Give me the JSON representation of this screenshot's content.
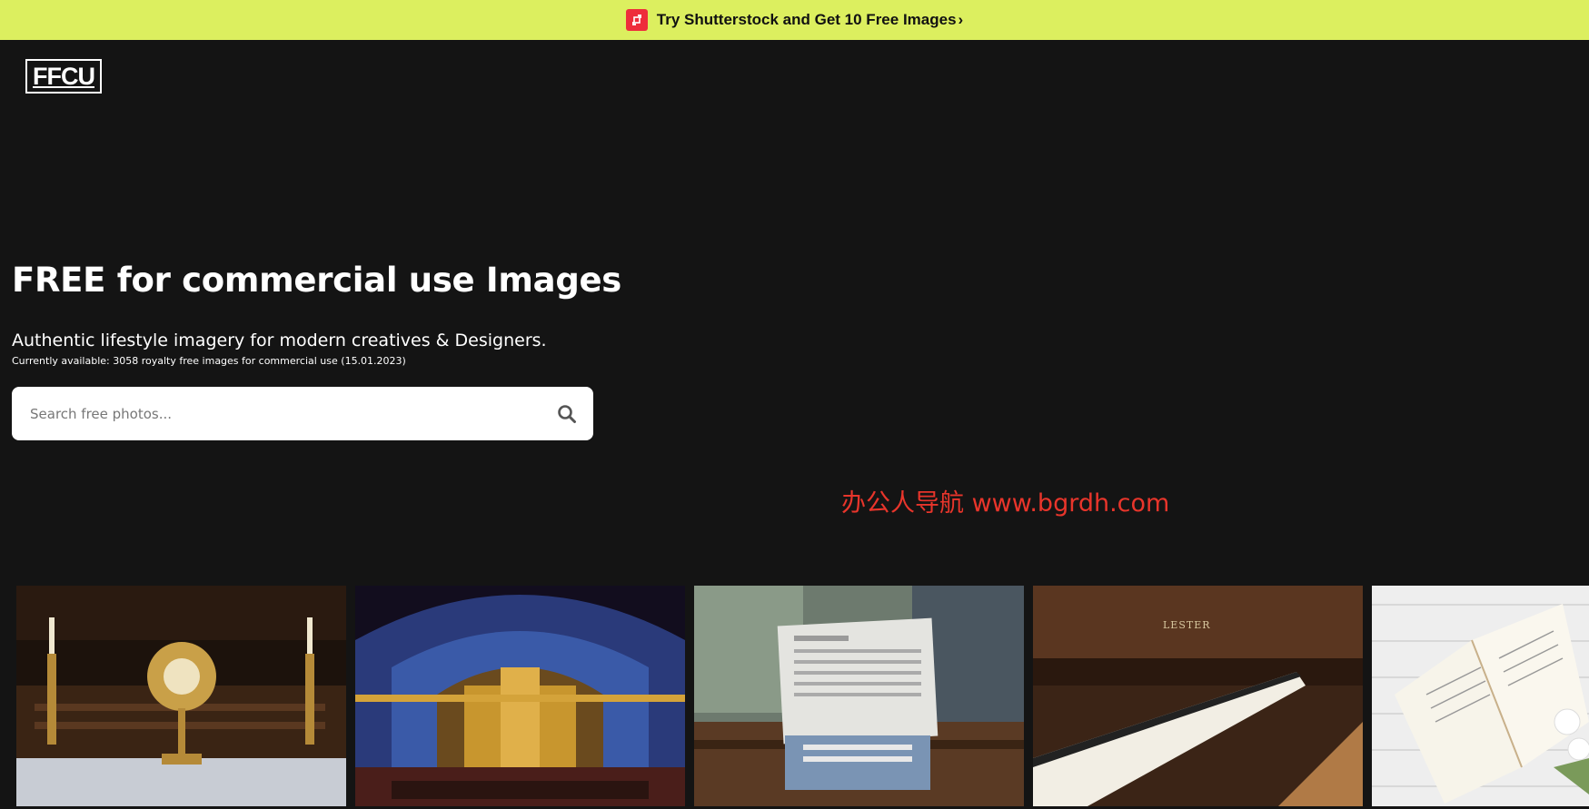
{
  "promo": {
    "label": "Try Shutterstock and Get 10 Free Images",
    "arrow": "›",
    "icon": "shutterstock-logo-icon",
    "background": "#dcef5f",
    "badge_color": "#ee2d3b"
  },
  "logo": {
    "text": "FFCU"
  },
  "hero": {
    "title": "FREE for commercial use Images",
    "subtitle": "Authentic lifestyle imagery for modern creatives & Designers.",
    "note": "Currently available: 3058 royalty free images for commercial use (15.01.2023)"
  },
  "search": {
    "placeholder": "Search free photos...",
    "value": "",
    "icon": "search-icon"
  },
  "watermark": {
    "text": "办公人导航 www.bgrdh.com",
    "color": "#e8352b"
  },
  "gallery": {
    "images": [
      {
        "name": "monstrance-altar-photo",
        "piano_label": ""
      },
      {
        "name": "basilica-interior-photo",
        "piano_label": ""
      },
      {
        "name": "man-reading-newspaper-photo",
        "piano_label": ""
      },
      {
        "name": "piano-keys-photo",
        "piano_label": "LESTER"
      },
      {
        "name": "open-book-photo",
        "piano_label": ""
      }
    ]
  },
  "colors": {
    "page_background": "#141414",
    "text": "#ffffff"
  }
}
